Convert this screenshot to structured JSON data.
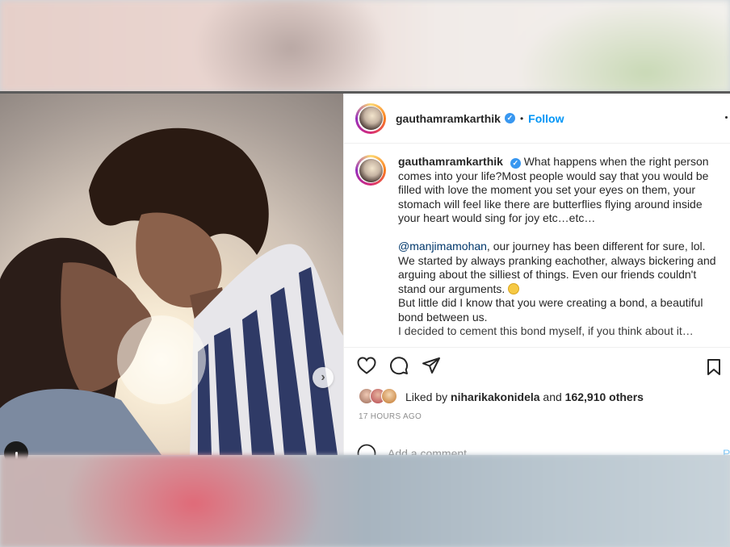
{
  "post": {
    "username": "gauthamramkarthik",
    "verified_badge": "✓",
    "separator": "•",
    "follow_label": "Follow",
    "caption": {
      "username": "gauthamramkarthik",
      "line1": "What happens when the right person comes into your life?Most people would say that you would be filled with love the moment you set your eyes on them, your stomach will feel like there are butterflies flying around inside your heart would sing for joy etc…etc…",
      "mention": "@manjimamohan",
      "line2": ", our journey has been different for sure, lol. We started by always pranking eachother, always bickering and arguing about the silliest of things. Even our friends couldn't stand our arguments.",
      "line3": "But little did I know that you were creating a bond, a beautiful bond between us.",
      "line4": "I decided to cement this bond myself, if you think about it…"
    },
    "likes": {
      "prefix": "Liked by",
      "user": "niharikakonidela",
      "connector": "and",
      "others": "162,910 others"
    },
    "timestamp": "17 HOURS AGO",
    "comment": {
      "placeholder": "Add a comment...",
      "post_label": "Post"
    },
    "carousel_next": "›"
  },
  "icons": [
    "heart-icon",
    "comment-icon",
    "share-icon",
    "bookmark-icon",
    "emoji-icon",
    "chevron-right-icon",
    "more-options-icon",
    "verified-icon",
    "user-tag-icon"
  ],
  "colors": {
    "link": "#0095f6",
    "mention": "#00376b",
    "muted": "#8e8e8e",
    "text": "#262626"
  }
}
